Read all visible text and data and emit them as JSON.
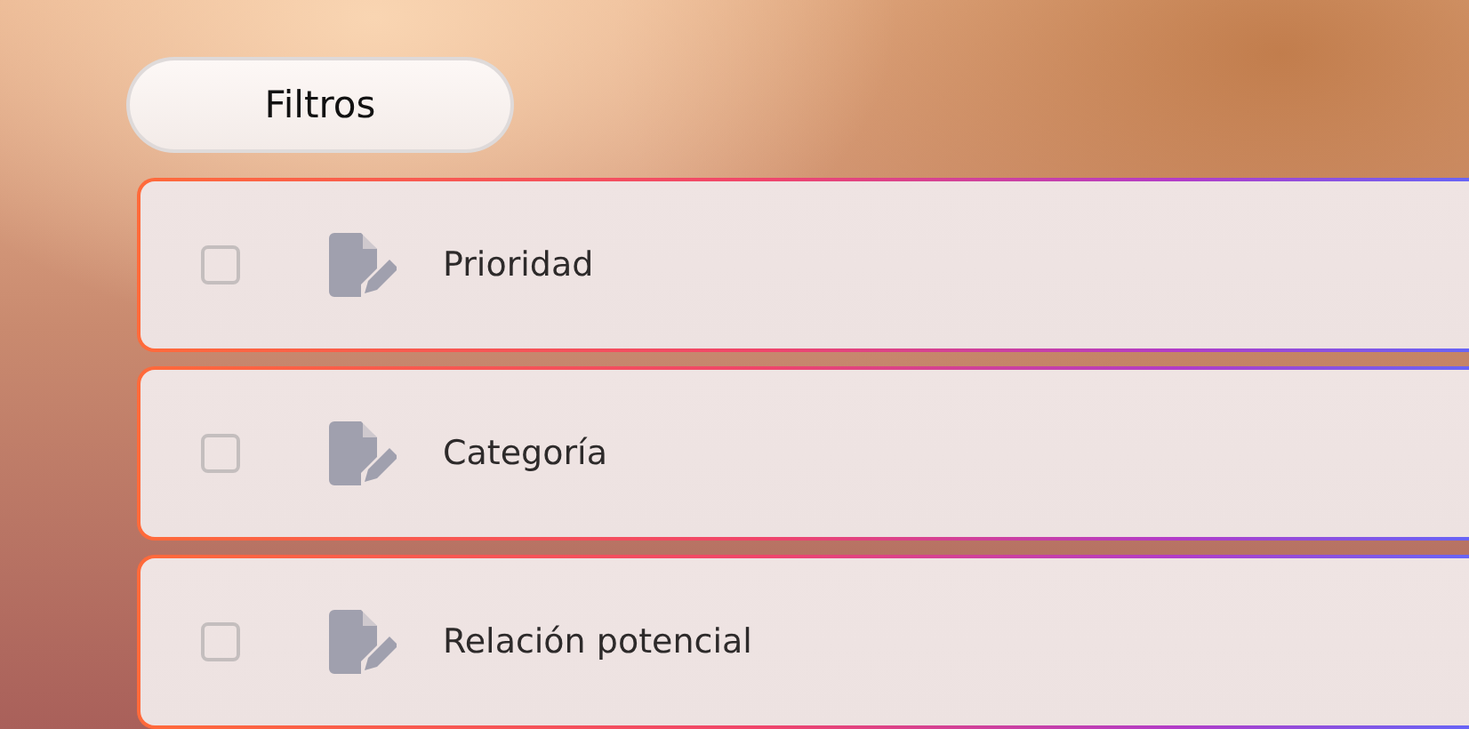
{
  "filter_button": {
    "label": "Filtros"
  },
  "items": [
    {
      "label": "Prioridad",
      "checked": false
    },
    {
      "label": "Categoría",
      "checked": false
    },
    {
      "label": "Relación potencial",
      "checked": false
    }
  ]
}
